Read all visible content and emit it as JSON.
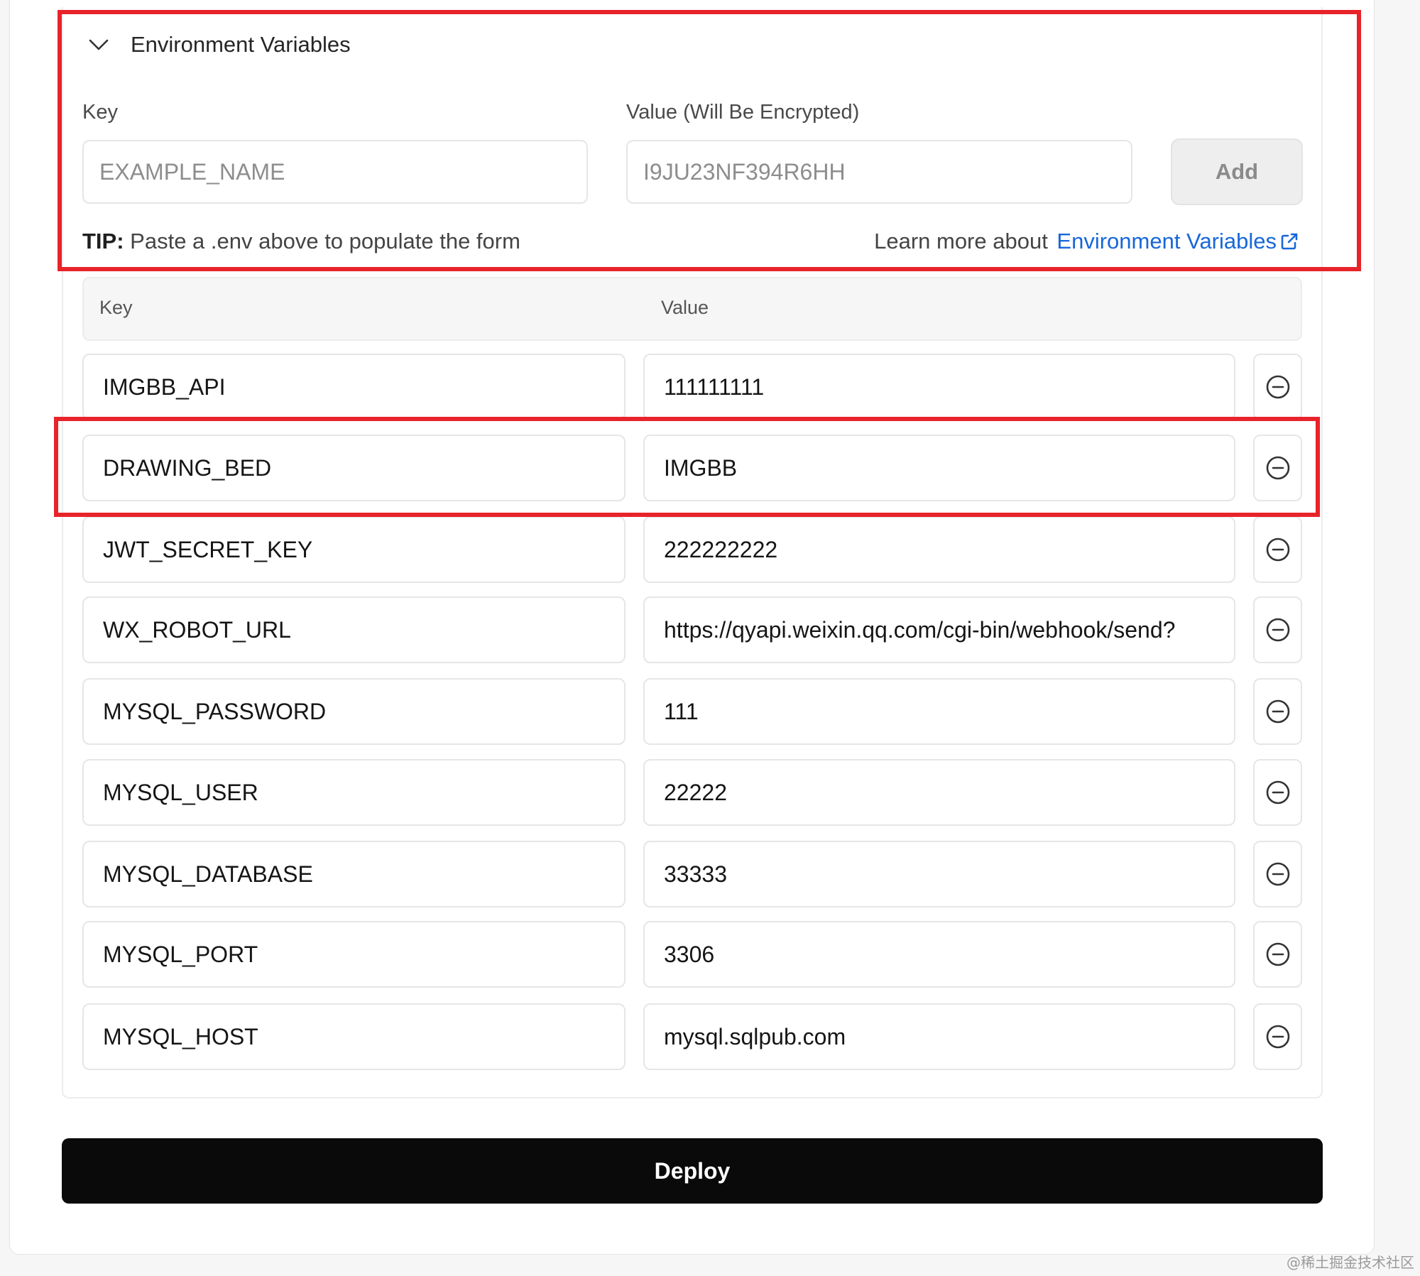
{
  "env_section": {
    "title": "Environment Variables",
    "key_label": "Key",
    "value_label": "Value (Will Be Encrypted)",
    "key_placeholder": "EXAMPLE_NAME",
    "value_placeholder": "I9JU23NF394R6HH",
    "add_label": "Add",
    "tip_prefix": "TIP:",
    "tip_text": " Paste a .env above to populate the form",
    "learn_prefix": "Learn more about ",
    "learn_link": "Environment Variables",
    "toggle_icon": "chevron-down-icon",
    "external_icon": "external-link-icon"
  },
  "table": {
    "header_key": "Key",
    "header_value": "Value",
    "remove_icon": "minus-circle-icon",
    "rows": [
      {
        "key": "IMGBB_API",
        "value": "111111111"
      },
      {
        "key": "DRAWING_BED",
        "value": "IMGBB"
      },
      {
        "key": "JWT_SECRET_KEY",
        "value": "222222222"
      },
      {
        "key": "WX_ROBOT_URL",
        "value": "https://qyapi.weixin.qq.com/cgi-bin/webhook/send?"
      },
      {
        "key": "MYSQL_PASSWORD",
        "value": "111"
      },
      {
        "key": "MYSQL_USER",
        "value": "22222"
      },
      {
        "key": "MYSQL_DATABASE",
        "value": "33333"
      },
      {
        "key": "MYSQL_PORT",
        "value": "3306"
      },
      {
        "key": "MYSQL_HOST",
        "value": "mysql.sqlpub.com"
      }
    ]
  },
  "deploy_label": "Deploy",
  "colors": {
    "highlight": "#e8232a",
    "link": "#1767d9",
    "deploy_bg": "#0a0a0a"
  },
  "watermark": "@稀土掘金技术社区"
}
